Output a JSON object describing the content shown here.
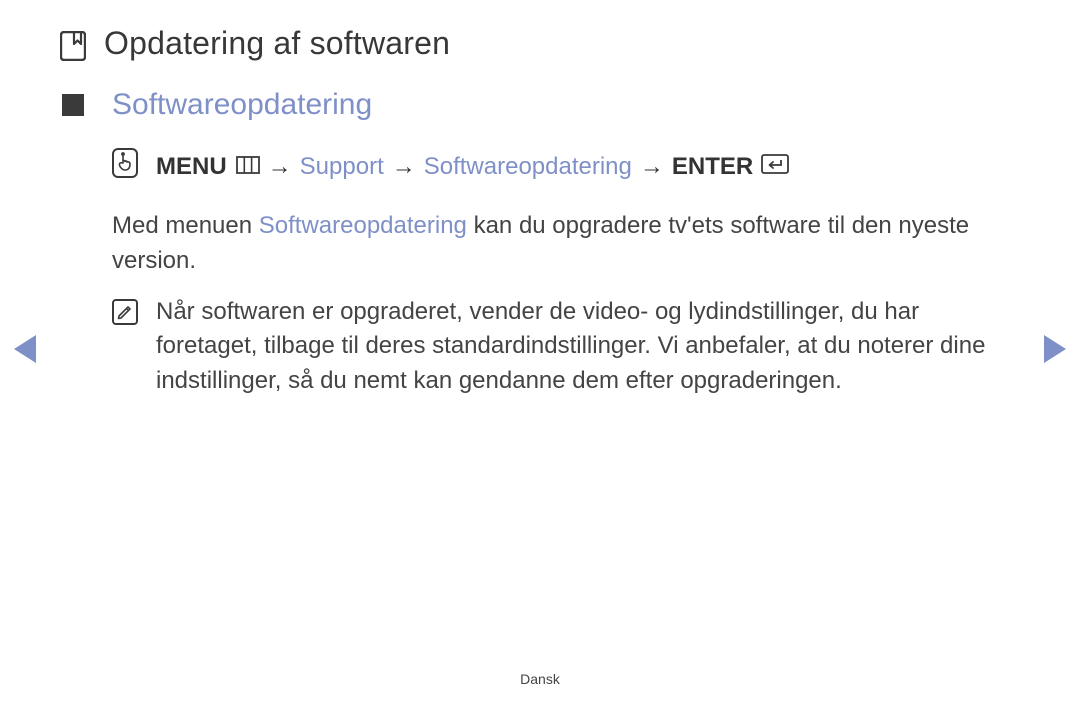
{
  "title": "Opdatering af softwaren",
  "section": "Softwareopdatering",
  "nav": {
    "menu": "MENU",
    "support": "Support",
    "update": "Softwareopdatering",
    "enter": "ENTER",
    "arrow": "→"
  },
  "body": {
    "pre": "Med menuen ",
    "accent": "Softwareopdatering",
    "post": " kan du opgradere tv'ets software til den nyeste version."
  },
  "note": "Når softwaren er opgraderet, vender de video- og lydindstillinger, du har foretaget, tilbage til deres standardindstillinger. Vi anbefaler, at du noterer dine indstillinger, så du nemt kan gendanne dem efter opgraderingen.",
  "footer": "Dansk"
}
